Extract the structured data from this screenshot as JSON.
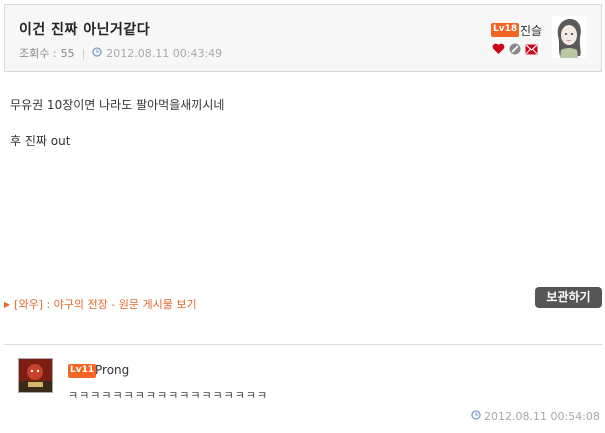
{
  "post": {
    "title": "이건 진짜 아닌거같다",
    "views_label": "조회수 :",
    "views_value": "55",
    "datetime": "2012.08.11 00:43:49"
  },
  "author": {
    "level": "18",
    "name": "진슬",
    "icons": [
      "heart-icon",
      "block-icon",
      "mail-icon"
    ]
  },
  "body": {
    "lines": [
      "무유권 10장이면 나라도 팔아먹을새끼시네",
      "후 진짜 out"
    ]
  },
  "source_link": "[와우] : 야구의 전장 - 원문 게시물 보기",
  "save_button": "보관하기",
  "comment": {
    "level": "11",
    "author": "Prong",
    "text": "ㅋㅋㅋㅋㅋㅋㅋㅋㅋㅋㅋㅋㅋㅋㅋㅋㅋㅋ",
    "datetime": "2012.08.11 00:54:08"
  },
  "colors": {
    "accent_orange": "#f26522",
    "link_orange": "#e26a2c",
    "heart_red": "#d0021b",
    "button_dark": "#555555"
  }
}
